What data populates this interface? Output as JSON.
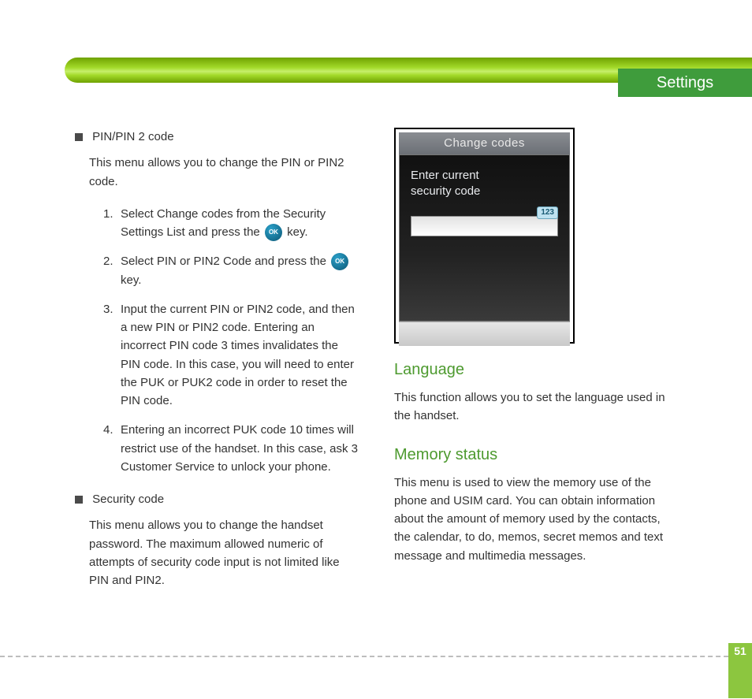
{
  "header": {
    "title": "Settings"
  },
  "page_number": "51",
  "left": {
    "block1": {
      "title": "PIN/PIN 2 code",
      "intro": "This menu allows you to change the PIN or PIN2 code.",
      "steps": {
        "s1_a": "Select Change codes from the Security Settings List and press the ",
        "s1_b": " key.",
        "s2_a": "Select PIN or PIN2 Code and press the ",
        "s2_b": " key.",
        "s3": "Input the current PIN or PIN2 code, and then a new PIN or PIN2 code. Entering an incorrect PIN code 3 times invalidates the PIN code. In this case, you will need to enter the PUK or PUK2 code in order to reset the PIN code.",
        "s4": "Entering an incorrect PUK code 10 times will restrict use of the handset. In this case, ask 3 Customer Service to unlock your phone."
      },
      "ok_label": "OK",
      "nums": {
        "n1": "1.",
        "n2": "2.",
        "n3": "3.",
        "n4": "4."
      }
    },
    "block2": {
      "title": "Security code",
      "body": "This menu allows you to change the handset password. The maximum allowed numeric of attempts of security code input is not limited like PIN and PIN2."
    }
  },
  "right": {
    "phone": {
      "title": "Change codes",
      "prompt_line1": "Enter current",
      "prompt_line2": "security code",
      "input_mode_badge": "123"
    },
    "language": {
      "heading": "Language",
      "body": "This function allows you to set the language used in the handset."
    },
    "memory": {
      "heading": "Memory status",
      "body": "This menu is used to view the memory use of the phone and USIM card. You can obtain information about the amount of memory used by the contacts, the calendar, to do, memos, secret memos and text message and multimedia messages."
    }
  }
}
